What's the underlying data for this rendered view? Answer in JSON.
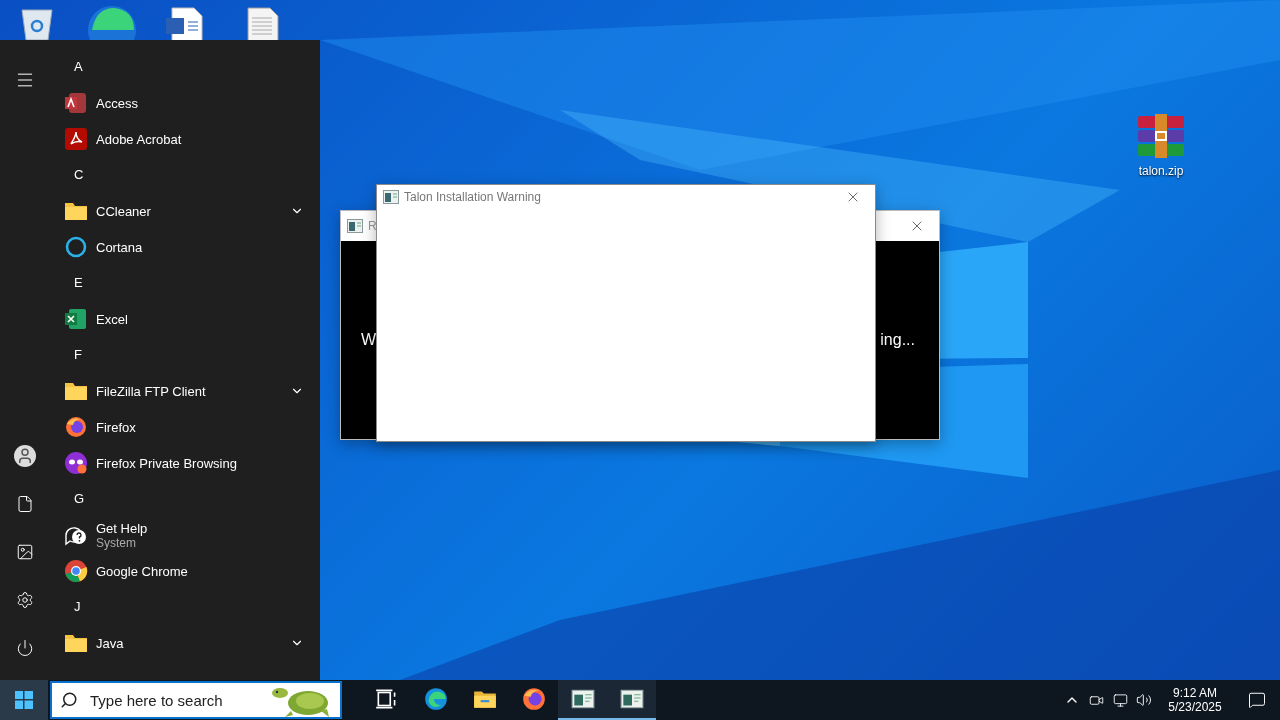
{
  "desktop": {
    "icons": [
      {
        "label": "talon.zip"
      }
    ]
  },
  "windows": [
    {
      "title": "R",
      "body_left": "W",
      "body_right": "ing...",
      "focused": false
    },
    {
      "title": "Talon Installation Warning",
      "focused": true
    }
  ],
  "start_menu": {
    "sections": [
      {
        "letter": "A",
        "apps": [
          {
            "name": "Access",
            "kind": "access"
          },
          {
            "name": "Adobe Acrobat",
            "kind": "acrobat"
          }
        ]
      },
      {
        "letter": "C",
        "apps": [
          {
            "name": "CCleaner",
            "kind": "folder",
            "expanded": false
          },
          {
            "name": "Cortana",
            "kind": "cortana"
          }
        ]
      },
      {
        "letter": "E",
        "apps": [
          {
            "name": "Excel",
            "kind": "excel"
          }
        ]
      },
      {
        "letter": "F",
        "apps": [
          {
            "name": "FileZilla FTP Client",
            "kind": "folder",
            "expanded": false
          },
          {
            "name": "Firefox",
            "kind": "firefox"
          },
          {
            "name": "Firefox Private Browsing",
            "kind": "private"
          }
        ]
      },
      {
        "letter": "G",
        "apps": [
          {
            "name": "Get Help",
            "subtitle": "System",
            "kind": "help"
          },
          {
            "name": "Google Chrome",
            "kind": "chrome"
          }
        ]
      },
      {
        "letter": "J",
        "apps": [
          {
            "name": "Java",
            "kind": "folder",
            "expanded": false
          }
        ]
      }
    ]
  },
  "taskbar": {
    "search": {
      "placeholder": "Type here to search"
    },
    "items": [
      {
        "kind": "taskview",
        "running": false
      },
      {
        "kind": "edge",
        "running": false
      },
      {
        "kind": "explorer",
        "running": false
      },
      {
        "kind": "firefox",
        "running": false
      },
      {
        "kind": "app",
        "running": true
      },
      {
        "kind": "app",
        "running": true
      }
    ],
    "clock": {
      "time": "9:12 AM",
      "date": "5/23/2025"
    }
  }
}
